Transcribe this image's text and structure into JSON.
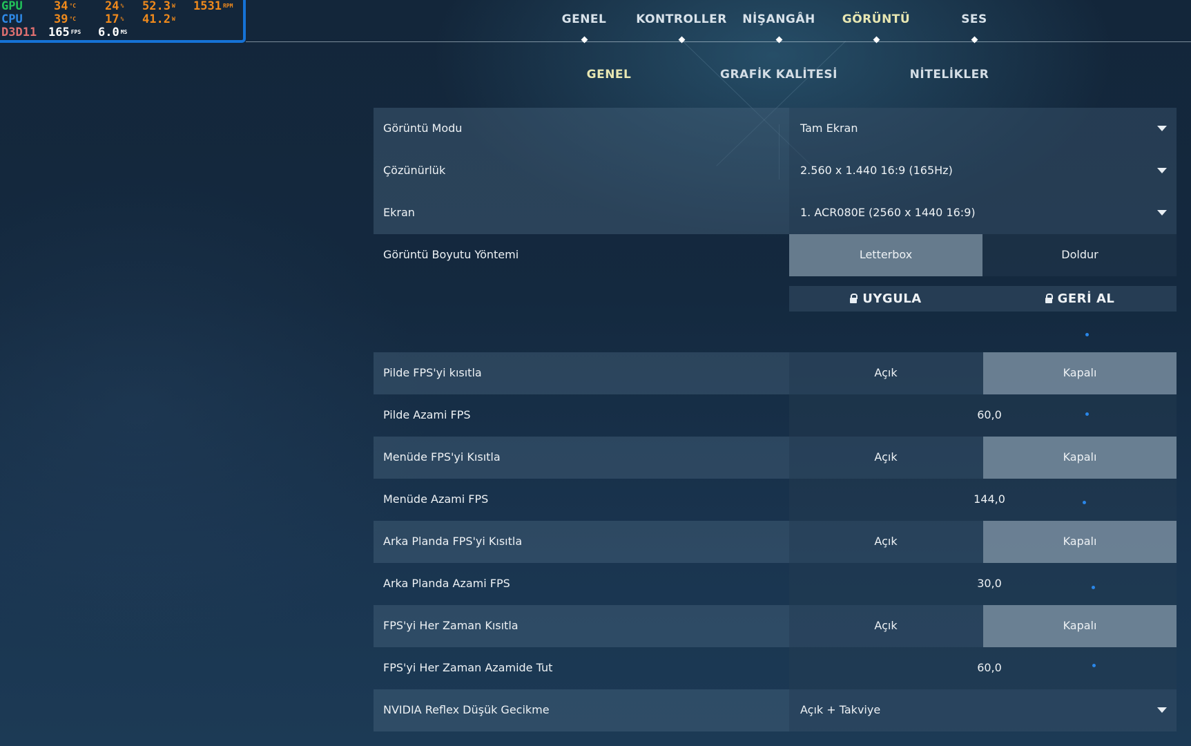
{
  "osd": {
    "gpu": {
      "label": "GPU",
      "temp": "34",
      "temp_unit": "°C",
      "load": "24",
      "load_unit": "%",
      "power": "52.3",
      "power_unit": "W",
      "fan": "1531",
      "fan_unit": "RPM"
    },
    "cpu": {
      "label": "CPU",
      "temp": "39",
      "temp_unit": "°C",
      "load": "17",
      "load_unit": "%",
      "power": "41.2",
      "power_unit": "W"
    },
    "api": {
      "label": "D3D11",
      "fps": "165",
      "fps_unit": "FPS",
      "frametime": "6.0",
      "frametime_unit": "MS"
    },
    "colors": {
      "gpu": "#22c35a",
      "cpu": "#2f8ae8",
      "api": "#e07070",
      "values": "#f08a1c",
      "white": "#ffffff",
      "border": "#1572d6"
    }
  },
  "main_tabs": [
    {
      "label": "GENEL"
    },
    {
      "label": "KONTROLLER"
    },
    {
      "label": "NİŞANGÂH"
    },
    {
      "label": "GÖRÜNTÜ",
      "active": true
    },
    {
      "label": "SES"
    }
  ],
  "sub_tabs": [
    {
      "label": "GENEL",
      "active": true
    },
    {
      "label": "GRAFİK KALİTESİ"
    },
    {
      "label": "NİTELİKLER"
    }
  ],
  "settings": {
    "display_mode": {
      "label": "Görüntü Modu",
      "value": "Tam Ekran"
    },
    "resolution": {
      "label": "Çözünürlük",
      "value": "2.560 x 1.440 16:9 (165Hz)"
    },
    "monitor": {
      "label": "Ekran",
      "value": "1. ACR080E (2560 x  1440 16:9)"
    },
    "aspect_method": {
      "label": "Görüntü Boyutu Yöntemi",
      "options": [
        "Letterbox",
        "Doldur"
      ],
      "selected": "Letterbox"
    },
    "actions": {
      "apply": "UYGULA",
      "revert": "GERİ AL"
    },
    "limit_fps_battery": {
      "label": "Pilde FPS'yi kısıtla",
      "options": [
        "Açık",
        "Kapalı"
      ],
      "selected": "Kapalı"
    },
    "max_fps_battery": {
      "label": "Pilde Azami FPS",
      "value": "60,0"
    },
    "limit_fps_menu": {
      "label": "Menüde FPS'yi Kısıtla",
      "options": [
        "Açık",
        "Kapalı"
      ],
      "selected": "Kapalı"
    },
    "max_fps_menu": {
      "label": "Menüde Azami FPS",
      "value": "144,0"
    },
    "limit_fps_background": {
      "label": "Arka Planda FPS'yi Kısıtla",
      "options": [
        "Açık",
        "Kapalı"
      ],
      "selected": "Kapalı"
    },
    "max_fps_background": {
      "label": "Arka Planda Azami FPS",
      "value": "30,0"
    },
    "limit_fps_always": {
      "label": "FPS'yi Her Zaman Kısıtla",
      "options": [
        "Açık",
        "Kapalı"
      ],
      "selected": "Kapalı"
    },
    "max_fps_always": {
      "label": "FPS'yi Her Zaman Azamide Tut",
      "value": "60,0"
    },
    "nvidia_reflex": {
      "label": "NVIDIA Reflex Düşük Gecikme",
      "value": "Açık + Takviye"
    }
  },
  "colors": {
    "active_tab": "#e8e7b2",
    "selected_segment": "#8094a6",
    "slider_dot": "#2a86e8"
  }
}
